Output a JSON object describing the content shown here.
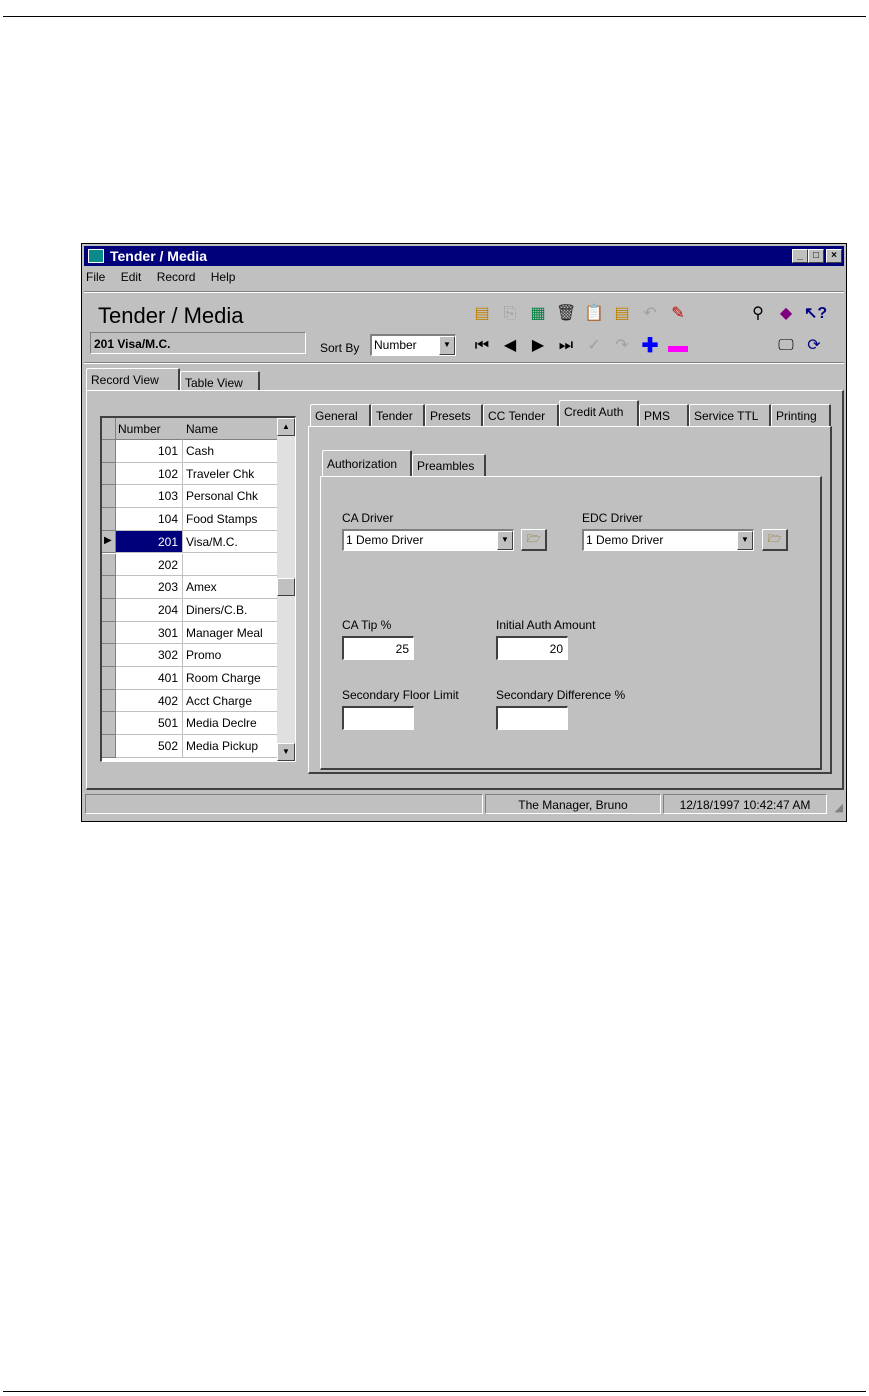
{
  "window": {
    "title": "Tender / Media",
    "controls": [
      "_",
      "□",
      "×"
    ]
  },
  "menu": [
    "File",
    "Edit",
    "Record",
    "Help"
  ],
  "header": {
    "title": "Tender / Media",
    "record_name": "201 Visa/M.C.",
    "sort_by_label": "Sort By",
    "sort_by_value": "Number"
  },
  "view_tabs": [
    "Record View",
    "Table View"
  ],
  "grid": {
    "columns": [
      "Number",
      "Name"
    ],
    "rows": [
      {
        "number": "101",
        "name": "Cash"
      },
      {
        "number": "102",
        "name": "Traveler Chk"
      },
      {
        "number": "103",
        "name": "Personal Chk"
      },
      {
        "number": "104",
        "name": "Food Stamps"
      },
      {
        "number": "201",
        "name": "Visa/M.C."
      },
      {
        "number": "202",
        "name": ""
      },
      {
        "number": "203",
        "name": "Amex"
      },
      {
        "number": "204",
        "name": "Diners/C.B."
      },
      {
        "number": "301",
        "name": "Manager Meal"
      },
      {
        "number": "302",
        "name": "Promo"
      },
      {
        "number": "401",
        "name": "Room Charge"
      },
      {
        "number": "402",
        "name": "Acct Charge"
      },
      {
        "number": "501",
        "name": "Media Declre"
      },
      {
        "number": "502",
        "name": "Media Pickup"
      }
    ],
    "selected_index": 4
  },
  "main_tabs": [
    "General",
    "Tender",
    "Presets",
    "CC Tender",
    "Credit Auth",
    "PMS",
    "Service TTL",
    "Printing"
  ],
  "active_main_tab": "Credit Auth",
  "sub_tabs": [
    "Authorization",
    "Preambles"
  ],
  "active_sub_tab": "Authorization",
  "form": {
    "ca_driver_label": "CA Driver",
    "ca_driver_value": "1  Demo Driver",
    "edc_driver_label": "EDC Driver",
    "edc_driver_value": "1  Demo Driver",
    "ca_tip_label": "CA Tip %",
    "ca_tip_value": "25",
    "initial_auth_label": "Initial Auth Amount",
    "initial_auth_value": "20",
    "secondary_floor_label": "Secondary Floor Limit",
    "secondary_floor_value": "",
    "secondary_diff_label": "Secondary Difference %",
    "secondary_diff_value": ""
  },
  "status_bar": {
    "message": "",
    "user": "The Manager, Bruno",
    "datetime": "12/18/1997 10:42:47 AM"
  },
  "icons": {
    "toolbar_top": [
      "new-record-icon",
      "copy-icon",
      "duplicate-icon",
      "delete-icon",
      "clipboard-icon",
      "paste-icon",
      "undo-icon",
      "edit-icon",
      "find-icon",
      "book-icon",
      "help-icon"
    ],
    "toolbar_bottom": [
      "first-record-icon",
      "prev-record-icon",
      "next-record-icon",
      "last-record-icon",
      "confirm-icon",
      "redo-icon",
      "add-icon",
      "remove-icon",
      "monitor-icon",
      "refresh-icon"
    ]
  }
}
